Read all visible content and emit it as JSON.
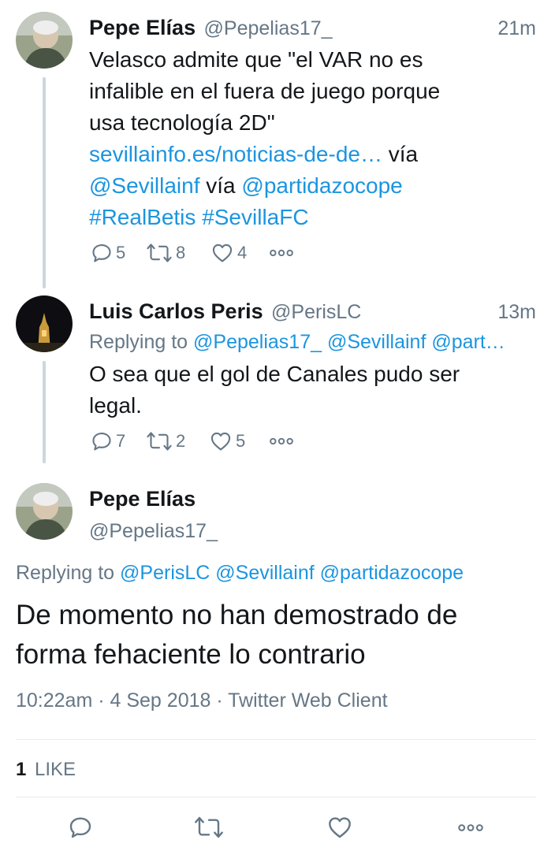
{
  "tweets": [
    {
      "name": "Pepe Elías",
      "handle": "@Pepelias17_",
      "time": "21m",
      "text_lines": [
        "Velasco admite que \"el VAR no es",
        "infalible en el fuera de juego porque",
        "usa tecnología 2D\""
      ],
      "link": "sevillainfo.es/noticias-de-de…",
      "via1": "vía",
      "mention1": "@Sevillainf",
      "via2": "vía",
      "mention2": "@partidazocope",
      "hashtag1": "#RealBetis",
      "hashtag2": "#SevillaFC",
      "replies": "5",
      "retweets": "8",
      "likes": "4"
    },
    {
      "name": "Luis Carlos Peris",
      "handle": "@PerisLC",
      "time": "13m",
      "replying_label": "Replying to",
      "replying_to": "@Pepelias17_ @Sevillainf @part…",
      "text_lines": [
        "O sea que el gol de Canales pudo ser",
        "legal."
      ],
      "replies": "7",
      "retweets": "2",
      "likes": "5"
    }
  ],
  "focus": {
    "name": "Pepe Elías",
    "handle": "@Pepelias17_",
    "replying_label": "Replying to",
    "replying_to": "@PerisLC @Sevillainf @partidazocope",
    "text_lines": [
      "De momento no han demostrado de",
      "forma fehaciente lo contrario"
    ],
    "meta": "10:22am · 4 Sep 2018 · Twitter Web Client",
    "likes_count": "1",
    "likes_label": "LIKE"
  },
  "icons": [
    "reply-icon",
    "retweet-icon",
    "like-icon",
    "more-icon"
  ],
  "colors": {
    "link": "#1b95e0",
    "muted": "#657786",
    "text": "#14171a",
    "divider": "#e6ecf0"
  }
}
